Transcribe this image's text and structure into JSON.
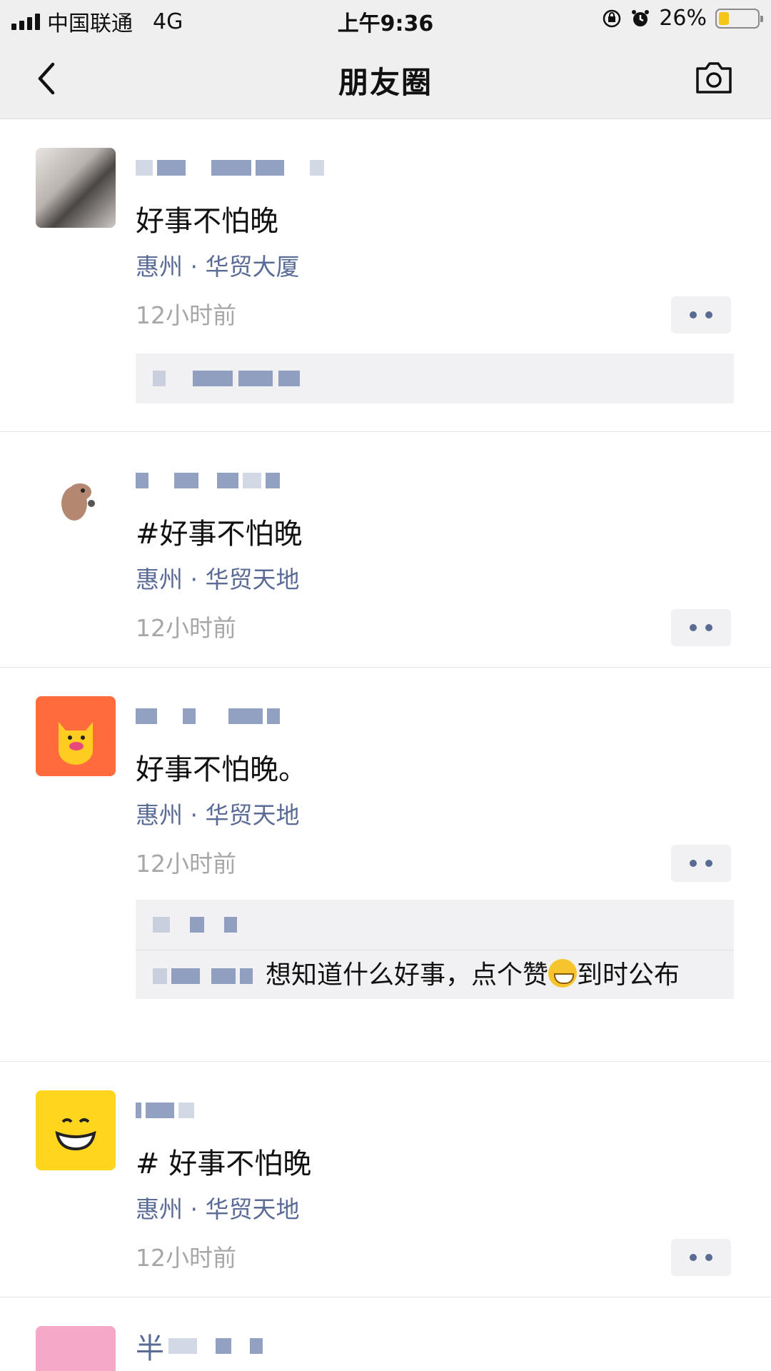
{
  "status_bar": {
    "carrier": "中国联通",
    "network": "4G",
    "time": "上午9:36",
    "battery_percent": "26%",
    "battery_level": 0.26,
    "icons": [
      "signal-icon",
      "orientation-lock-icon",
      "alarm-icon",
      "battery-icon"
    ]
  },
  "nav": {
    "title": "朋友圈",
    "back_icon": "chevron-left-icon",
    "camera_icon": "camera-icon"
  },
  "posts": [
    {
      "text": "好事不怕晚",
      "location": "惠州 · 华贸大厦",
      "time": "12小时前"
    },
    {
      "text": "#好事不怕晚",
      "location": "惠州 · 华贸天地",
      "time": "12小时前"
    },
    {
      "text": "好事不怕晚。",
      "location": "惠州 · 华贸天地",
      "time": "12小时前",
      "comment": {
        "text": "想知道什么好事，点个赞",
        "emoji": "grinning-emoji",
        "text_after": "到时公布"
      }
    },
    {
      "text": "# 好事不怕晚",
      "location": "惠州 · 华贸天地",
      "time": "12小时前"
    },
    {
      "name_visible": "半"
    }
  ],
  "colors": {
    "link": "#5a6b96",
    "time": "#a7a7a7",
    "bar": "#efefef",
    "battery": "#f5c518"
  }
}
